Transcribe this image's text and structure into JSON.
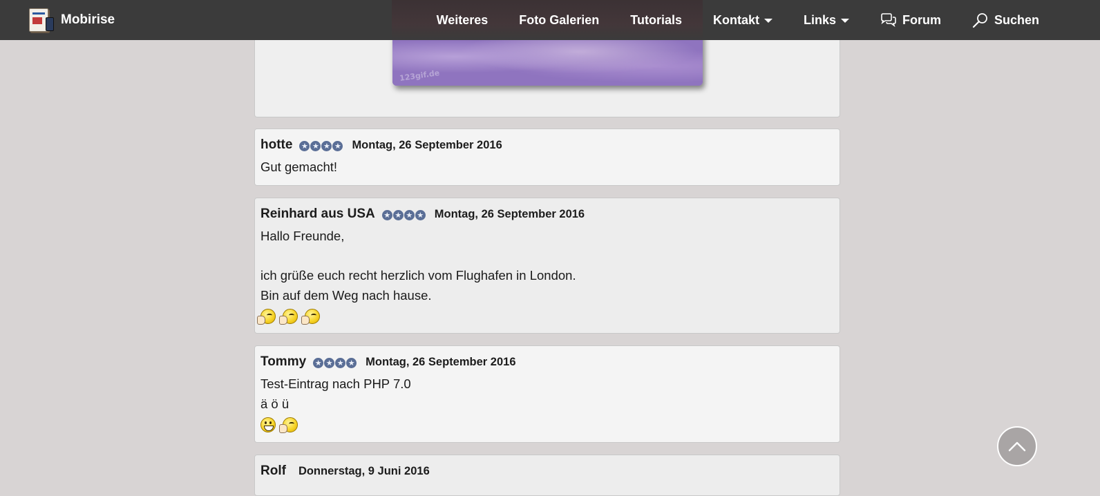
{
  "navbar": {
    "brand": "Mobirise",
    "items": [
      {
        "label": "Weiteres"
      },
      {
        "label": "Foto Galerien"
      },
      {
        "label": "Tutorials"
      },
      {
        "label": "Kontakt"
      },
      {
        "label": "Links"
      },
      {
        "label": "Forum",
        "icon": "chat-bubbles-icon"
      },
      {
        "label": "Suchen",
        "icon": "magnifier-icon"
      }
    ]
  },
  "image": {
    "watermark": "123gif.de"
  },
  "entries": [
    {
      "name": "hotte",
      "stars": 4,
      "date": "Montag, 26 September 2016",
      "lines": [
        "Gut gemacht!"
      ],
      "emojis": []
    },
    {
      "name": "Reinhard aus USA",
      "stars": 4,
      "date": "Montag, 26 September 2016",
      "lines": [
        "Hallo Freunde,",
        "",
        "ich grüße euch recht herzlich vom Flughafen in London.",
        "Bin auf dem Weg nach hause."
      ],
      "emojis": [
        "thumbs-up-smiley-icon",
        "thumbs-up-smiley-icon",
        "thumbs-up-smiley-icon"
      ]
    },
    {
      "name": "Tommy",
      "stars": 4,
      "date": "Montag, 26 September 2016",
      "lines": [
        "Test-Eintrag nach PHP 7.0",
        "ä ö ü"
      ],
      "emojis": [
        "grinning-smiley-icon",
        "thumbs-up-smiley-icon"
      ]
    },
    {
      "name": "Rolf",
      "stars": 0,
      "date": "Donnerstag, 9 Juni 2016",
      "lines": [],
      "emojis": []
    }
  ],
  "scroll_top": {
    "icon": "chevron-up-icon"
  },
  "colors": {
    "navbar": "#3b3b3b",
    "page_background": "#d8d4d4",
    "card_background": "#f4f4f4",
    "star": "#5a6e96",
    "scroll_button": "#a9a5a5"
  }
}
